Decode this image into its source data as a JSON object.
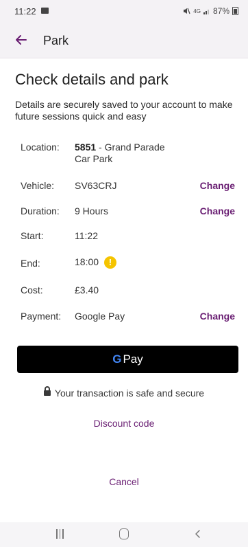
{
  "status_bar": {
    "time": "11:22",
    "battery": "87%",
    "signal_text": "4G"
  },
  "app_bar": {
    "title": "Park"
  },
  "page": {
    "title": "Check details and park",
    "description": "Details are securely saved to your account to make future sessions quick and easy"
  },
  "details": {
    "location": {
      "label": "Location:",
      "code": "5851",
      "name": " - Grand Parade",
      "name_line2": "Car Park"
    },
    "vehicle": {
      "label": "Vehicle:",
      "value": "SV63CRJ",
      "action": "Change"
    },
    "duration": {
      "label": "Duration:",
      "value": "9 Hours",
      "action": "Change"
    },
    "start": {
      "label": "Start:",
      "value": "11:22"
    },
    "end": {
      "label": "End:",
      "value": "18:00",
      "warning": "!"
    },
    "cost": {
      "label": "Cost:",
      "value": "£3.40"
    },
    "payment": {
      "label": "Payment:",
      "value": "Google Pay",
      "action": "Change"
    }
  },
  "gpay_button": {
    "g": "G",
    "label": "Pay"
  },
  "secure_text": "Your transaction is safe and secure",
  "discount_link": "Discount code",
  "cancel_link": "Cancel",
  "colors": {
    "accent": "#6a1f73",
    "warning": "#f5c400",
    "header_bg": "#f4f2f5"
  }
}
